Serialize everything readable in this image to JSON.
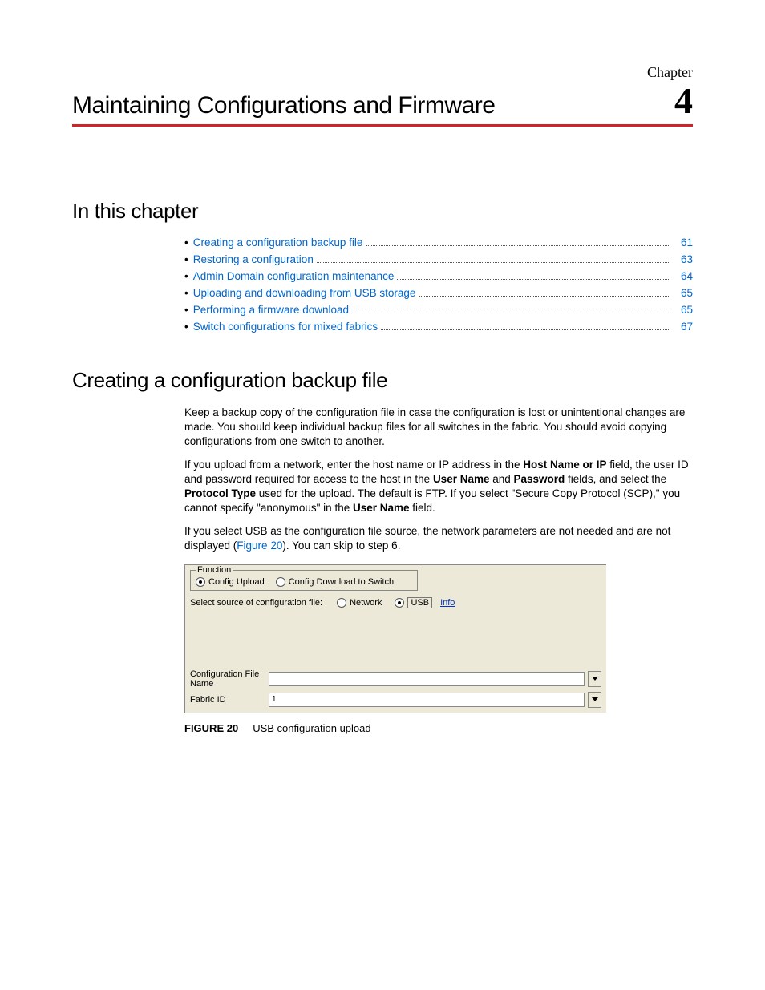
{
  "header": {
    "chapter_label": "Chapter",
    "chapter_number": "4",
    "chapter_title": "Maintaining Configurations and Firmware"
  },
  "sections": {
    "in_this_chapter": "In this chapter",
    "creating_backup": "Creating a configuration backup file"
  },
  "toc": [
    {
      "label": "Creating a configuration backup file",
      "page": "61"
    },
    {
      "label": "Restoring a configuration",
      "page": "63"
    },
    {
      "label": "Admin Domain configuration maintenance",
      "page": "64"
    },
    {
      "label": "Uploading and downloading from USB storage",
      "page": "65"
    },
    {
      "label": "Performing a firmware download",
      "page": "65"
    },
    {
      "label": "Switch configurations for mixed fabrics",
      "page": "67"
    }
  ],
  "body": {
    "p1": "Keep a backup copy of the configuration file in case the configuration is lost or unintentional changes are made. You should keep individual backup files for all switches in the fabric. You should avoid copying configurations from one switch to another.",
    "p2_a": "If you upload from a network, enter the host name or IP address in the ",
    "p2_b": " field, the user ID and password required for access to the host in the ",
    "p2_c": " and ",
    "p2_d": " fields, and select the ",
    "p2_e": " used for the upload. The default is FTP. If you select \"Secure Copy Protocol (SCP),\" you cannot specify \"anonymous\" in the ",
    "p2_f": " field.",
    "bold": {
      "host": "Host Name or IP",
      "user": "User Name",
      "password": "Password",
      "protocol": "Protocol Type",
      "user2": "User Name"
    },
    "p3_a": "If you select USB as the configuration file source, the network parameters are not needed and are not displayed (",
    "p3_link": "Figure 20",
    "p3_b": "). You can skip to step 6."
  },
  "screenshot": {
    "fieldset_label": "Function",
    "radio_upload": "Config Upload",
    "radio_download": "Config Download to Switch",
    "source_label": "Select source of configuration file:",
    "network": "Network",
    "usb": "USB",
    "info": "Info",
    "config_filename_label": "Configuration File Name",
    "config_filename_value": "",
    "fabric_id_label": "Fabric ID",
    "fabric_id_value": "1"
  },
  "figure": {
    "label": "FIGURE 20",
    "caption": "USB configuration upload"
  }
}
